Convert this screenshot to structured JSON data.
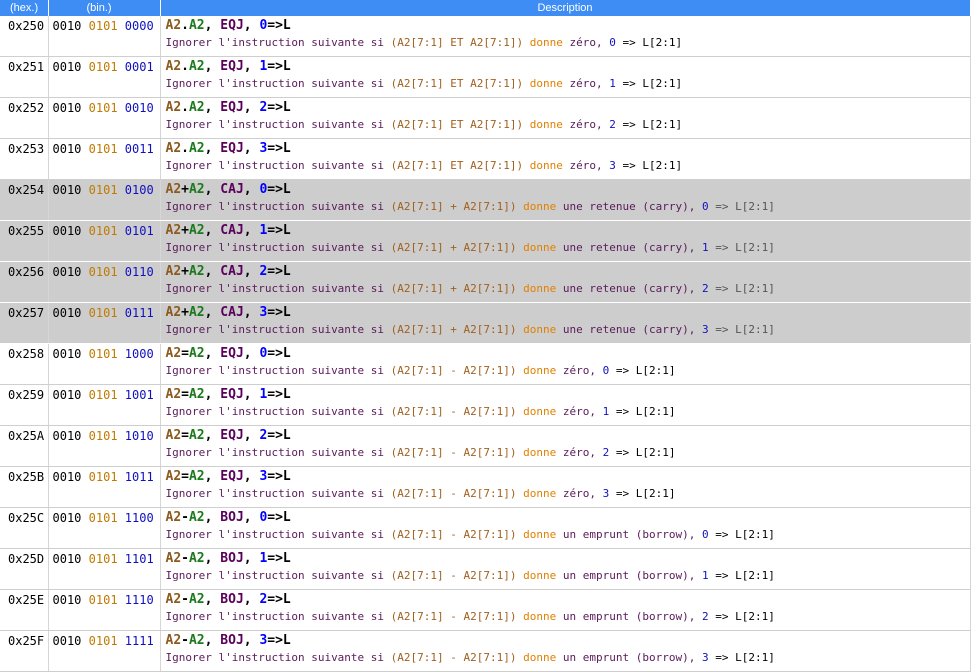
{
  "header": {
    "hex": "(hex.)",
    "bin": "(bin.)",
    "desc": "Description"
  },
  "rows": [
    {
      "hex": "0x250",
      "b1": "0010",
      "b2": "0101",
      "b3": "0000",
      "a1": "A2",
      "op": ".",
      "a2": "A2",
      "cond": "EQJ",
      "n": "0",
      "desc": "Ignorer l'instruction suivante si",
      "reg": "(A2[7:1] ET A2[7:1])",
      "verb": "donne",
      "what": "zéro,",
      "tail": "=> L[2:1]",
      "hl": false
    },
    {
      "hex": "0x251",
      "b1": "0010",
      "b2": "0101",
      "b3": "0001",
      "a1": "A2",
      "op": ".",
      "a2": "A2",
      "cond": "EQJ",
      "n": "1",
      "desc": "Ignorer l'instruction suivante si",
      "reg": "(A2[7:1] ET A2[7:1])",
      "verb": "donne",
      "what": "zéro,",
      "tail": "=> L[2:1]",
      "hl": false
    },
    {
      "hex": "0x252",
      "b1": "0010",
      "b2": "0101",
      "b3": "0010",
      "a1": "A2",
      "op": ".",
      "a2": "A2",
      "cond": "EQJ",
      "n": "2",
      "desc": "Ignorer l'instruction suivante si",
      "reg": "(A2[7:1] ET A2[7:1])",
      "verb": "donne",
      "what": "zéro,",
      "tail": "=> L[2:1]",
      "hl": false
    },
    {
      "hex": "0x253",
      "b1": "0010",
      "b2": "0101",
      "b3": "0011",
      "a1": "A2",
      "op": ".",
      "a2": "A2",
      "cond": "EQJ",
      "n": "3",
      "desc": "Ignorer l'instruction suivante si",
      "reg": "(A2[7:1] ET A2[7:1])",
      "verb": "donne",
      "what": "zéro,",
      "tail": "=> L[2:1]",
      "hl": false
    },
    {
      "hex": "0x254",
      "b1": "0010",
      "b2": "0101",
      "b3": "0100",
      "a1": "A2",
      "op": "+",
      "a2": "A2",
      "cond": "CAJ",
      "n": "0",
      "desc": "Ignorer l'instruction suivante si",
      "reg": "(A2[7:1] + A2[7:1])",
      "verb": "donne",
      "what": "une retenue (carry),",
      "tail": "=> L[2:1]",
      "hl": true
    },
    {
      "hex": "0x255",
      "b1": "0010",
      "b2": "0101",
      "b3": "0101",
      "a1": "A2",
      "op": "+",
      "a2": "A2",
      "cond": "CAJ",
      "n": "1",
      "desc": "Ignorer l'instruction suivante si",
      "reg": "(A2[7:1] + A2[7:1])",
      "verb": "donne",
      "what": "une retenue (carry),",
      "tail": "=> L[2:1]",
      "hl": true
    },
    {
      "hex": "0x256",
      "b1": "0010",
      "b2": "0101",
      "b3": "0110",
      "a1": "A2",
      "op": "+",
      "a2": "A2",
      "cond": "CAJ",
      "n": "2",
      "desc": "Ignorer l'instruction suivante si",
      "reg": "(A2[7:1] + A2[7:1])",
      "verb": "donne",
      "what": "une retenue (carry),",
      "tail": "=> L[2:1]",
      "hl": true
    },
    {
      "hex": "0x257",
      "b1": "0010",
      "b2": "0101",
      "b3": "0111",
      "a1": "A2",
      "op": "+",
      "a2": "A2",
      "cond": "CAJ",
      "n": "3",
      "desc": "Ignorer l'instruction suivante si",
      "reg": "(A2[7:1] + A2[7:1])",
      "verb": "donne",
      "what": "une retenue (carry),",
      "tail": "=> L[2:1]",
      "hl": true
    },
    {
      "hex": "0x258",
      "b1": "0010",
      "b2": "0101",
      "b3": "1000",
      "a1": "A2",
      "op": "=",
      "a2": "A2",
      "cond": "EQJ",
      "n": "0",
      "desc": "Ignorer l'instruction suivante si",
      "reg": "(A2[7:1] - A2[7:1])",
      "verb": "donne",
      "what": "zéro,",
      "tail": "=> L[2:1]",
      "hl": false
    },
    {
      "hex": "0x259",
      "b1": "0010",
      "b2": "0101",
      "b3": "1001",
      "a1": "A2",
      "op": "=",
      "a2": "A2",
      "cond": "EQJ",
      "n": "1",
      "desc": "Ignorer l'instruction suivante si",
      "reg": "(A2[7:1] - A2[7:1])",
      "verb": "donne",
      "what": "zéro,",
      "tail": "=> L[2:1]",
      "hl": false
    },
    {
      "hex": "0x25A",
      "b1": "0010",
      "b2": "0101",
      "b3": "1010",
      "a1": "A2",
      "op": "=",
      "a2": "A2",
      "cond": "EQJ",
      "n": "2",
      "desc": "Ignorer l'instruction suivante si",
      "reg": "(A2[7:1] - A2[7:1])",
      "verb": "donne",
      "what": "zéro,",
      "tail": "=> L[2:1]",
      "hl": false
    },
    {
      "hex": "0x25B",
      "b1": "0010",
      "b2": "0101",
      "b3": "1011",
      "a1": "A2",
      "op": "=",
      "a2": "A2",
      "cond": "EQJ",
      "n": "3",
      "desc": "Ignorer l'instruction suivante si",
      "reg": "(A2[7:1] - A2[7:1])",
      "verb": "donne",
      "what": "zéro,",
      "tail": "=> L[2:1]",
      "hl": false
    },
    {
      "hex": "0x25C",
      "b1": "0010",
      "b2": "0101",
      "b3": "1100",
      "a1": "A2",
      "op": "-",
      "a2": "A2",
      "cond": "BOJ",
      "n": "0",
      "desc": "Ignorer l'instruction suivante si",
      "reg": "(A2[7:1] - A2[7:1])",
      "verb": "donne",
      "what": "un emprunt (borrow),",
      "tail": "=> L[2:1]",
      "hl": false
    },
    {
      "hex": "0x25D",
      "b1": "0010",
      "b2": "0101",
      "b3": "1101",
      "a1": "A2",
      "op": "-",
      "a2": "A2",
      "cond": "BOJ",
      "n": "1",
      "desc": "Ignorer l'instruction suivante si",
      "reg": "(A2[7:1] - A2[7:1])",
      "verb": "donne",
      "what": "un emprunt (borrow),",
      "tail": "=> L[2:1]",
      "hl": false
    },
    {
      "hex": "0x25E",
      "b1": "0010",
      "b2": "0101",
      "b3": "1110",
      "a1": "A2",
      "op": "-",
      "a2": "A2",
      "cond": "BOJ",
      "n": "2",
      "desc": "Ignorer l'instruction suivante si",
      "reg": "(A2[7:1] - A2[7:1])",
      "verb": "donne",
      "what": "un emprunt (borrow),",
      "tail": "=> L[2:1]",
      "hl": false
    },
    {
      "hex": "0x25F",
      "b1": "0010",
      "b2": "0101",
      "b3": "1111",
      "a1": "A2",
      "op": "-",
      "a2": "A2",
      "cond": "BOJ",
      "n": "3",
      "desc": "Ignorer l'instruction suivante si",
      "reg": "(A2[7:1] - A2[7:1])",
      "verb": "donne",
      "what": "un emprunt (borrow),",
      "tail": "=> L[2:1]",
      "hl": false
    }
  ]
}
